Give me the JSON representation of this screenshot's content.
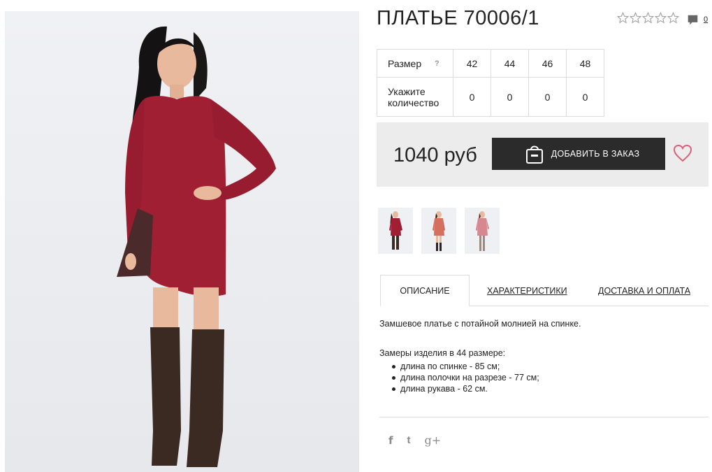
{
  "product": {
    "title": "ПЛАТЬЕ 70006/1",
    "rating_icon": "star-outline-icon",
    "comment_count": "0"
  },
  "size_table": {
    "size_label": "Размер",
    "help": "?",
    "sizes": [
      "42",
      "44",
      "46",
      "48"
    ],
    "qty_label": "Укажите количество",
    "quantities": [
      "0",
      "0",
      "0",
      "0"
    ]
  },
  "purchase": {
    "price": "1040 руб",
    "order_label": "ДОБАВИТЬ В ЗАКАЗ",
    "accent_color": "#d9607a"
  },
  "tabs": {
    "description": "ОПИСАНИЕ",
    "characteristics": "ХАРАКТЕРИСТИКИ",
    "delivery": "ДОСТАВКА И ОПЛАТА"
  },
  "description": {
    "intro": "Замшевое платье с потайной молнией на спинке.",
    "measurements_title": "Замеры изделия в 44 размере:",
    "items": [
      "длина по спинке - 85 см;",
      "длина полочки на разрезе - 77 см;",
      "длина рукава - 62 см."
    ]
  },
  "social": {
    "facebook": "f",
    "twitter": "t",
    "google": "g+"
  },
  "colors": {
    "dress_main": "#a01f33",
    "dress_thumb2": "#d5705f",
    "dress_thumb3": "#d6878f",
    "button_bg": "#2b2b2b"
  }
}
